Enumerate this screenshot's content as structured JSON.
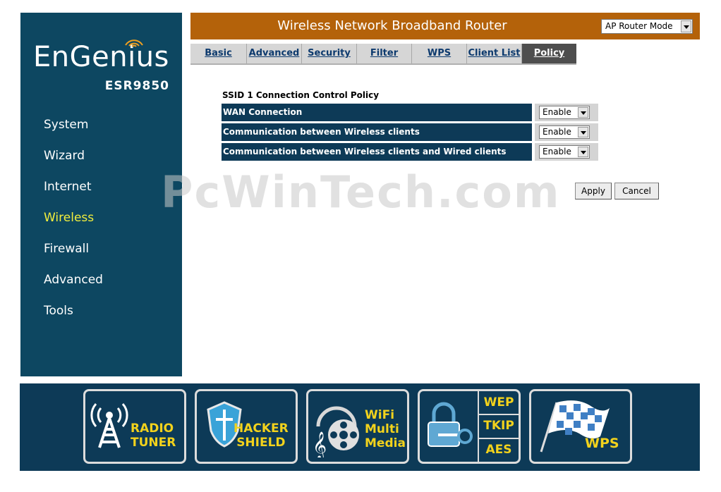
{
  "brand": {
    "wordmark": "EnGenius",
    "model": "ESR9850"
  },
  "sidebar": {
    "items": [
      {
        "label": "System"
      },
      {
        "label": "Wizard"
      },
      {
        "label": "Internet"
      },
      {
        "label": "Wireless",
        "active": true
      },
      {
        "label": "Firewall"
      },
      {
        "label": "Advanced"
      },
      {
        "label": "Tools"
      }
    ]
  },
  "header": {
    "title": "Wireless Network Broadband Router",
    "mode_value": "AP Router Mode"
  },
  "tabs": [
    {
      "label": "Basic"
    },
    {
      "label": "Advanced"
    },
    {
      "label": "Security"
    },
    {
      "label": "Filter"
    },
    {
      "label": "WPS"
    },
    {
      "label": "Client List"
    },
    {
      "label": "Policy",
      "active": true
    }
  ],
  "policy": {
    "title": "SSID 1 Connection Control Policy",
    "rows": [
      {
        "label": "WAN Connection",
        "value": "Enable"
      },
      {
        "label": "Communication between Wireless clients",
        "value": "Enable"
      },
      {
        "label": "Communication between Wireless clients and Wired clients",
        "value": "Enable"
      }
    ]
  },
  "buttons": {
    "apply": "Apply",
    "cancel": "Cancel"
  },
  "watermark": "PcWinTech.com",
  "banner": {
    "radio_tuner": {
      "line1": "RADIO",
      "line2": "TUNER"
    },
    "hacker_shield": {
      "line1": "HACKER",
      "line2": "SHIELD"
    },
    "wifi_multimedia": {
      "line1": "WiFi",
      "line2": "Multi",
      "line3": "Media"
    },
    "encryption": {
      "wep": "WEP",
      "tkip": "TKIP",
      "aes": "AES"
    },
    "wps": {
      "label": "WPS"
    }
  },
  "colors": {
    "sidebar": "#0d4761",
    "header": "#b4620a",
    "active_nav": "#f2ee3c",
    "banner": "#0d3a57",
    "banner_text": "#f2d21c"
  }
}
